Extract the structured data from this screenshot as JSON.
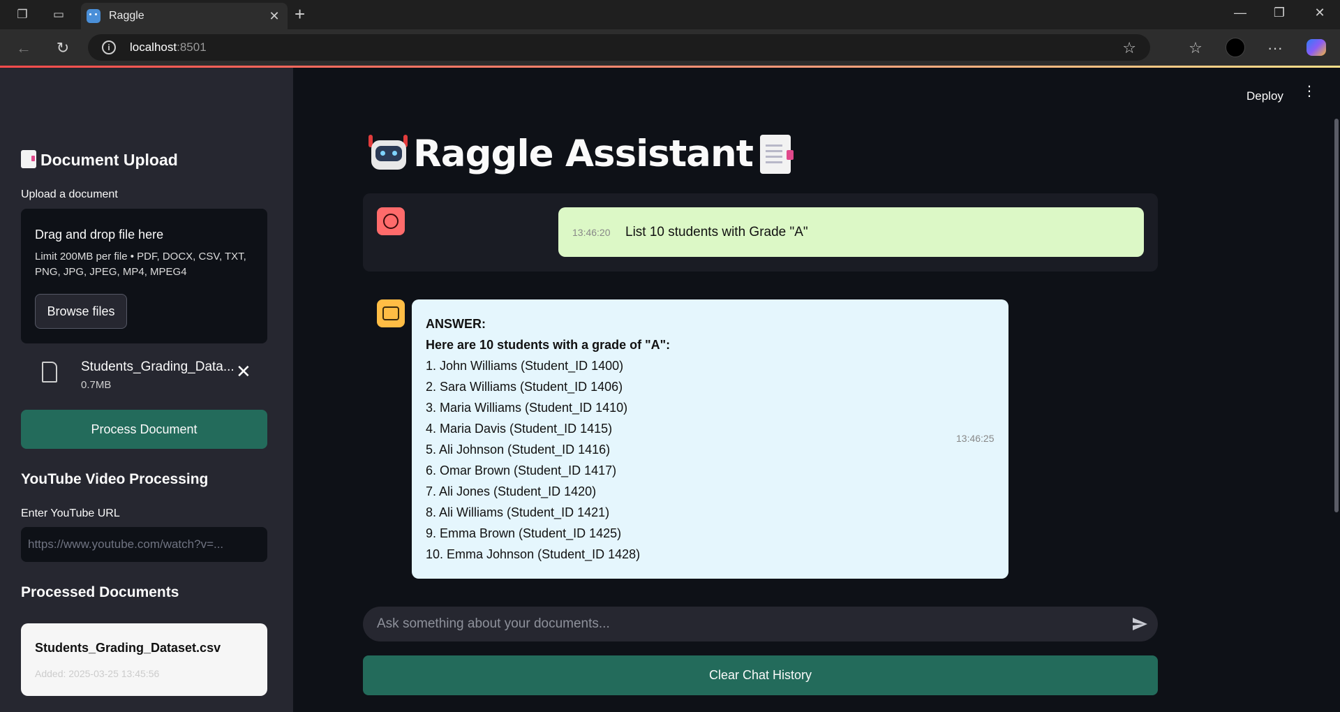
{
  "browser": {
    "tab_title": "Raggle",
    "url_host": "localhost",
    "url_port": ":8501"
  },
  "sidebar": {
    "upload_heading": "Document Upload",
    "upload_label": "Upload a document",
    "dropzone_title": "Drag and drop file here",
    "dropzone_limit": "Limit 200MB per file • PDF, DOCX, CSV, TXT, PNG, JPG, JPEG, MP4, MPEG4",
    "browse_label": "Browse files",
    "file": {
      "name": "Students_Grading_Data...",
      "size": "0.7MB"
    },
    "process_label": "Process Document",
    "youtube_heading": "YouTube Video Processing",
    "youtube_label": "Enter YouTube URL",
    "youtube_placeholder": "https://www.youtube.com/watch?v=...",
    "processed_heading": "Processed Documents",
    "processed": {
      "name": "Students_Grading_Dataset.csv",
      "added": "Added: 2025-03-25 13:45:56"
    }
  },
  "header": {
    "deploy_label": "Deploy"
  },
  "main": {
    "title": "Raggle Assistant",
    "user_message": {
      "time": "13:46:20",
      "text": "List 10 students with Grade \"A\""
    },
    "bot_message": {
      "time": "13:46:25",
      "answer_label": "ANSWER:",
      "intro": "Here are 10 students with a grade of \"A\":",
      "items": [
        "1. John Williams (Student_ID 1400)",
        "2. Sara Williams (Student_ID 1406)",
        "3. Maria Williams (Student_ID 1410)",
        "4. Maria Davis (Student_ID 1415)",
        "5. Ali Johnson (Student_ID 1416)",
        "6. Omar Brown (Student_ID 1417)",
        "7. Ali Jones (Student_ID 1420)",
        "8. Ali Williams (Student_ID 1421)",
        "9. Emma Brown (Student_ID 1425)",
        "10. Emma Johnson (Student_ID 1428)"
      ]
    },
    "chat_placeholder": "Ask something about your documents...",
    "clear_label": "Clear Chat History"
  }
}
